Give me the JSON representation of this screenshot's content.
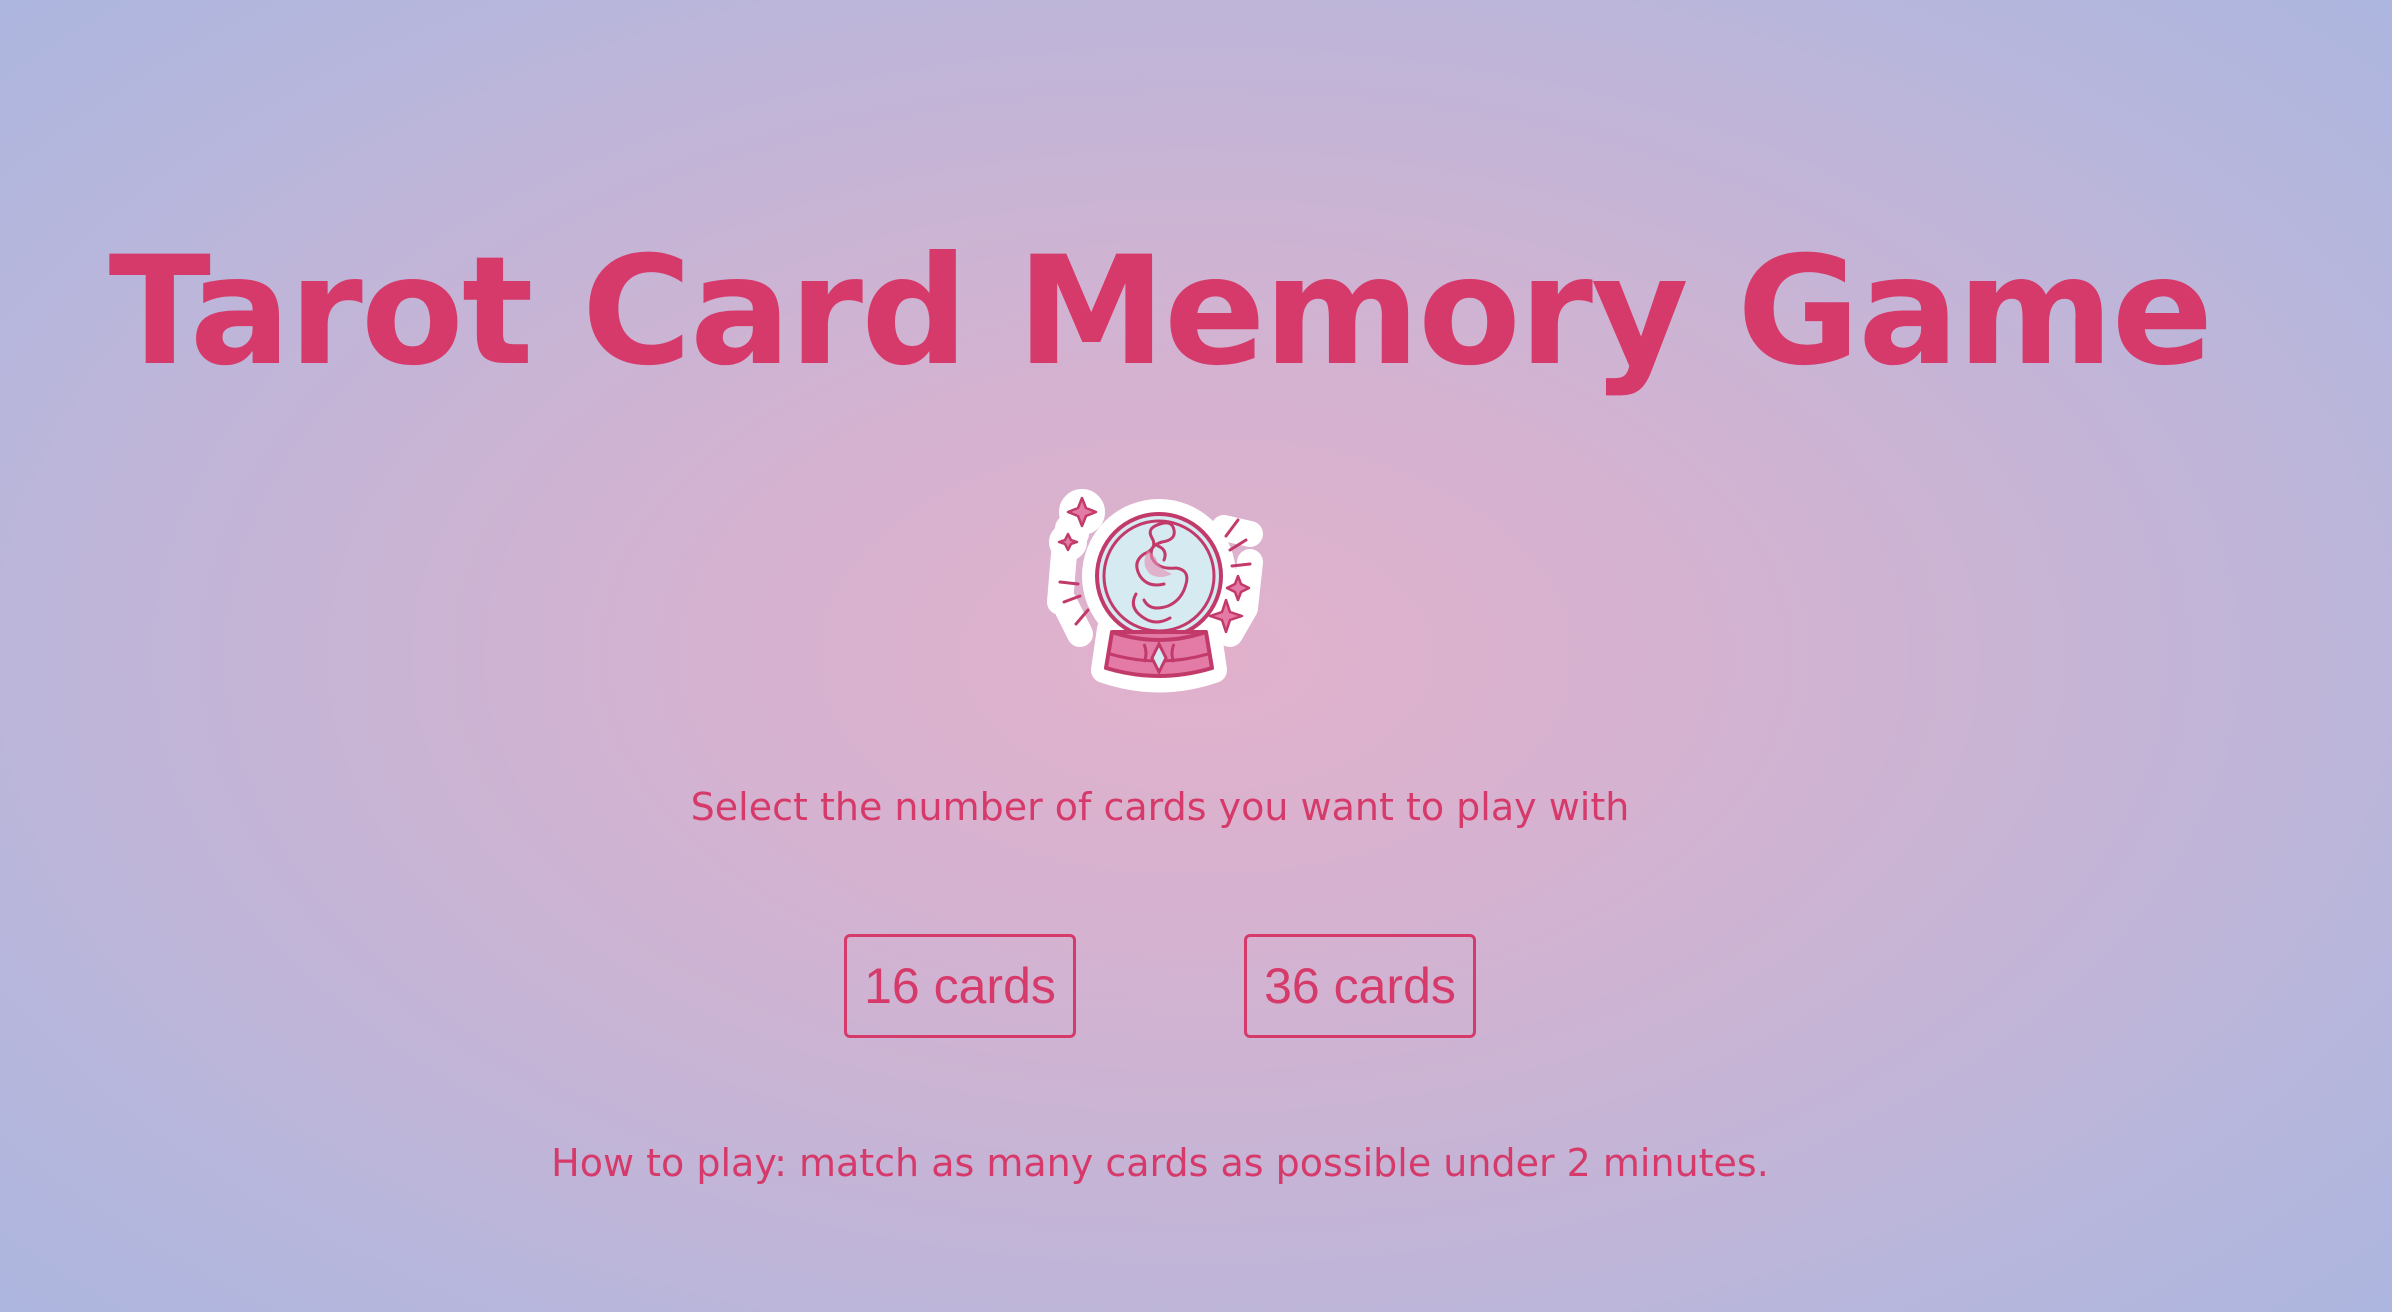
{
  "page": {
    "title": "Tarot Card Memory Game",
    "logo_icon": "crystal-ball-icon",
    "instruction": "Select the number of cards you want to play with",
    "options": [
      {
        "label": "16 cards"
      },
      {
        "label": "36 cards"
      }
    ],
    "how_to_play": "How to play: match as many cards as possible under 2 minutes."
  },
  "colors": {
    "accent": "#d63a6a",
    "background_center": "#e2b1cc",
    "background_edge": "#a4b7e2",
    "ball_fill": "#d6eaf2",
    "sticker_outline": "#ffffff"
  }
}
